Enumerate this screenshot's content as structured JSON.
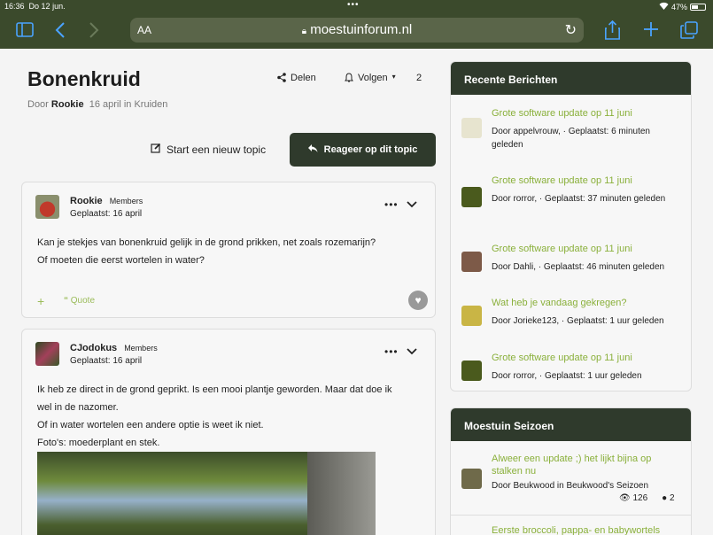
{
  "status": {
    "time": "16:36",
    "date": "Do 12 jun.",
    "dots": "•••",
    "battery": "47%"
  },
  "browser": {
    "aa": "AA",
    "url": "moestuinforum.nl"
  },
  "topic": {
    "title": "Bonenkruid",
    "by_prefix": "Door",
    "author": "Rookie",
    "meta": "16 april in Kruiden",
    "share_label": "Delen",
    "follow_label": "Volgen",
    "follow_count": "2",
    "new_topic_label": "Start een nieuw topic",
    "reply_label": "Reageer op dit topic"
  },
  "posts": [
    {
      "author": "Rookie",
      "role": "Members",
      "posted": "Geplaatst: 16 april",
      "lines": [
        "Kan je stekjes van bonenkruid gelijk in de grond prikken, net zoals rozemarijn?",
        "Of moeten die eerst wortelen in water?"
      ],
      "quote_label": "Quote",
      "plus_label": "+",
      "avatar_color": "#b33a2a"
    },
    {
      "author": "CJodokus",
      "role": "Members",
      "posted": "Geplaatst: 16 april",
      "lines": [
        "Ik heb ze direct in de grond geprikt. Is een mooi plantje geworden. Maar dat doe ik",
        "wel in de nazomer.",
        "Of in water wortelen een andere optie is weet ik niet.",
        "Foto's: moederplant en stek."
      ],
      "avatar_color": "#7a3a52"
    }
  ],
  "recent": {
    "heading": "Recente Berichten",
    "items": [
      {
        "title": "Grote software update op 11 juni",
        "meta": "Door appelvrouw, · Geplaatst: 6 minuten geleden",
        "thumb": "#e7e4cf"
      },
      {
        "title": "Grote software update op 11 juni",
        "meta": "Door rorror, · Geplaatst: 37 minuten geleden",
        "thumb": "#4a5a1d"
      },
      {
        "title": "Grote software update op 11 juni",
        "meta": "Door Dahli, · Geplaatst: 46 minuten geleden",
        "thumb": "#7d5a48"
      },
      {
        "title": "Wat heb je vandaag gekregen?",
        "meta": "Door Jorieke123, · Geplaatst: 1 uur geleden",
        "thumb": "#c9b545"
      },
      {
        "title": "Grote software update op 11 juni",
        "meta": "Door rorror, · Geplaatst: 1 uur geleden",
        "thumb": "#4a5a1d"
      }
    ]
  },
  "season": {
    "heading": "Moestuin Seizoen",
    "items": [
      {
        "title": "Alweer een update ;) het lijkt bijna op stalken nu",
        "meta": "Door Beukwood in Beukwood's Seizoen",
        "views": "126",
        "replies": "2",
        "thumb": "#6f6a4a"
      },
      {
        "title": "Eerste broccoli, pappa- en babywortels",
        "meta": "",
        "thumb": "#5e7a3a"
      }
    ]
  }
}
